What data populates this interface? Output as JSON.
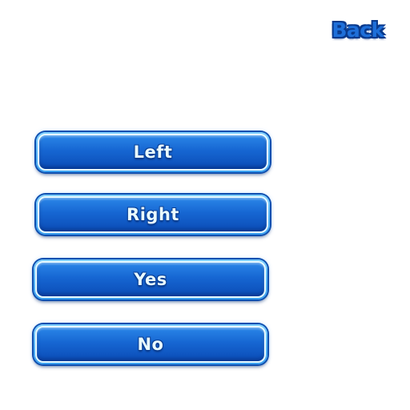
{
  "header": {
    "back_label": "Back"
  },
  "menu": {
    "buttons": [
      {
        "label": "Left"
      },
      {
        "label": "Right"
      },
      {
        "label": "Yes"
      },
      {
        "label": "No"
      }
    ]
  },
  "colors": {
    "button_fill": "#1666d2",
    "button_border": "#e8fbff",
    "label_text": "#e9fbff",
    "back_text": "#1e6fd9",
    "background": "#ffffff"
  }
}
